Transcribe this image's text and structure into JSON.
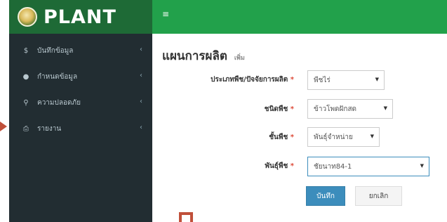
{
  "brand": {
    "title": "PLANT"
  },
  "topbar": {
    "menu_icon": "≡"
  },
  "sidebar": {
    "items": [
      {
        "icon": "$",
        "label": "บันทึกข้อมูล",
        "chevron": "‹"
      },
      {
        "icon": "●",
        "label": "กำหนดข้อมูล",
        "chevron": "‹"
      },
      {
        "icon": "⚲",
        "label": "ความปลอดภัย",
        "chevron": "‹"
      },
      {
        "icon": "⎙",
        "label": "รายงาน",
        "chevron": "‹"
      }
    ]
  },
  "page": {
    "title": "แผนการผลิต",
    "subtitle": "เพิ่ม"
  },
  "form": {
    "required_mark": "*",
    "fields": [
      {
        "label": "ประเภทพืช/ปัจจัยการผลิต",
        "value": "พืชไร่"
      },
      {
        "label": "ชนิดพืช",
        "value": "ข้าวโพดฝักสด"
      },
      {
        "label": "ชั้นพืช",
        "value": "พันธุ์จำหน่าย"
      },
      {
        "label": "พันธุ์พืช",
        "value": "ชัยนาท84-1"
      }
    ],
    "save_label": "บันทึก",
    "cancel_label": "ยกเลิก"
  }
}
